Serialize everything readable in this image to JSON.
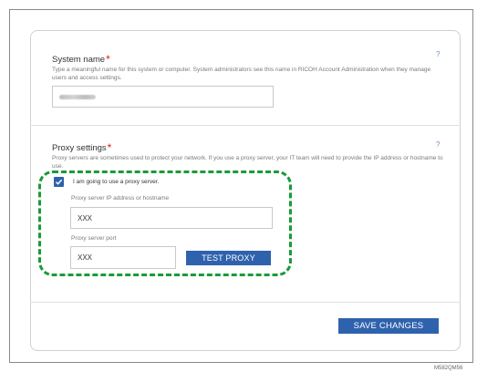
{
  "system_name": {
    "title": "System name",
    "required_mark": "*",
    "help": "?",
    "description": "Type a meaningful name for this system or computer. System administrators see this name in RICOH Account Administration when they manage users and access settings."
  },
  "proxy_settings": {
    "title": "Proxy settings",
    "required_mark": "*",
    "help": "?",
    "description": "Proxy servers are sometimes used to protect your network. If you use a proxy server, your IT team will need to provide the IP address or hostname to use.",
    "use_proxy_label": "I am going to use a proxy server.",
    "use_proxy_checked": true,
    "address_label": "Proxy server IP address or hostname",
    "address_value": "XXX",
    "port_label": "Proxy server port",
    "port_value": "XXX",
    "test_button": "TEST PROXY"
  },
  "footer": {
    "save_button": "SAVE CHANGES"
  },
  "figure_code": "M582QM56",
  "colors": {
    "accent": "#2f62ad",
    "required": "#d62020",
    "highlight": "#1a9a3a"
  }
}
